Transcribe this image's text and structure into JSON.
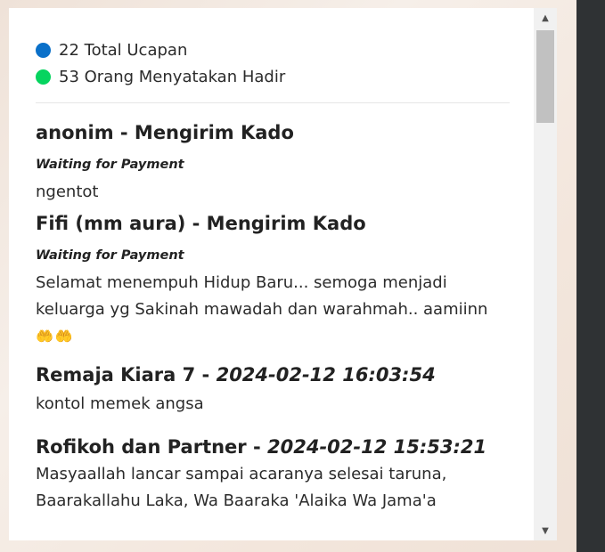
{
  "stats": [
    {
      "count": "22",
      "label": "22 Total Ucapan",
      "color": "#0d6efd"
    },
    {
      "count": "53",
      "label": "53 Orang Menyatakan Hadir",
      "color": "#05d46a"
    }
  ],
  "messages": [
    {
      "title": "anonim - Mengirim Kado",
      "status": "Waiting for Payment",
      "body": "ngentot"
    },
    {
      "title": "Fifi (mm aura) - Mengirim Kado",
      "status": "Waiting for Payment",
      "body_line1": "Selamat menempuh Hidup Baru... semoga menjadi",
      "body_line2": "keluarga yg Sakinah mawadah dan warahmah.. aamiinn",
      "emoji": "🤲🤲"
    },
    {
      "name": "Remaja Kiara 7 -",
      "date": "2024-02-12 16:03:54",
      "body": "kontol memek angsa"
    },
    {
      "name": "Rofikoh dan Partner -",
      "date": "2024-02-12 15:53:21",
      "body_line1": "Masyaallah lancar sampai acaranya selesai taruna,",
      "body_line2": "Baarakallahu Laka, Wa Baaraka 'Alaika Wa Jama'a"
    }
  ],
  "scrollbar": {
    "up_icon": "▲",
    "down_icon": "▼"
  }
}
